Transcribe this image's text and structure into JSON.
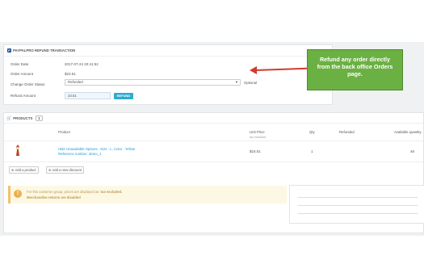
{
  "refund_panel": {
    "title": "PAYPALPRO REFUND TRANSACTION",
    "order_date_label": "Order Date",
    "order_date_value": "2017-07-24 20:41:52",
    "order_amount_label": "Order Amount",
    "order_amount_value": "$23.51",
    "change_status_label": "Change Order Status",
    "status_selected": "Refunded",
    "optional_label": "Optional",
    "refund_amount_label": "Refund Amount",
    "refund_amount_value": "23.51",
    "refund_button": "REFUND"
  },
  "callout": {
    "line1": "Refund any order directly",
    "line2": "from the back office Orders",
    "line3": "page."
  },
  "products_panel": {
    "title": "PRODUCTS",
    "count": "1",
    "columns": {
      "product": "Product",
      "unit_price": "Unit Price",
      "unit_price_sub": "tax excluded",
      "qty": "Qty",
      "refunded": "Refunded",
      "available_quantity": "Available quantity"
    },
    "row": {
      "name": "Hide Unavailable Options - Size : L, Color : Yellow",
      "reference": "Reference number: demo_1",
      "unit_price": "$16.51",
      "qty": "1",
      "available": "46"
    },
    "add_product_button": "Add a product",
    "add_discount_button": "Add a new discount",
    "alert_line1_prefix": "For this customer group, prices are displayed as:",
    "alert_line1_strong": "tax excluded.",
    "alert_line2": "Merchandise returns are disabled"
  },
  "colors": {
    "accent": "#2eacce",
    "callout_green": "#6bb043",
    "arrow_red": "#d23a2e",
    "link_blue": "#1e9ad6"
  }
}
